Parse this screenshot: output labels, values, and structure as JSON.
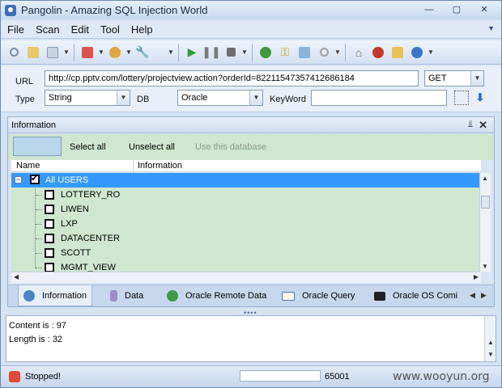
{
  "window": {
    "title": "Pangolin - Amazing SQL Injection World"
  },
  "menu": [
    "File",
    "Scan",
    "Edit",
    "Tool",
    "Help"
  ],
  "params": {
    "url_label": "URL",
    "url_value": "http://cp.pptv.com/lottery/projectview.action?orderId=82211547357412686184",
    "method": "GET",
    "type_label": "Type",
    "type_value": "String",
    "db_label": "DB",
    "db_value": "Oracle",
    "keyword_label": "KeyWord",
    "keyword_value": ""
  },
  "info_panel": {
    "title": "Information",
    "select_all": "Select all",
    "unselect_all": "Unselect all",
    "use_db": "Use this database",
    "col_name": "Name",
    "col_info": "Information",
    "root": "All USERS",
    "users": [
      "LOTTERY_RO",
      "LIWEN",
      "LXP",
      "DATACENTER",
      "SCOTT",
      "MGMT_VIEW"
    ],
    "tabs": [
      "Information",
      "Data",
      "Oracle Remote Data",
      "Oracle Query",
      "Oracle OS Comi"
    ]
  },
  "output": {
    "line1": "Content is : 97",
    "line2": "Length is : 32"
  },
  "status": {
    "text": "Stopped!",
    "count": "65001",
    "progress_fraction": 0.0
  },
  "watermark": "www.wooyun.org",
  "colors": {
    "selection": "#3399ff",
    "tree_bg": "#cfe6cf",
    "accent": "#3d6db5"
  }
}
